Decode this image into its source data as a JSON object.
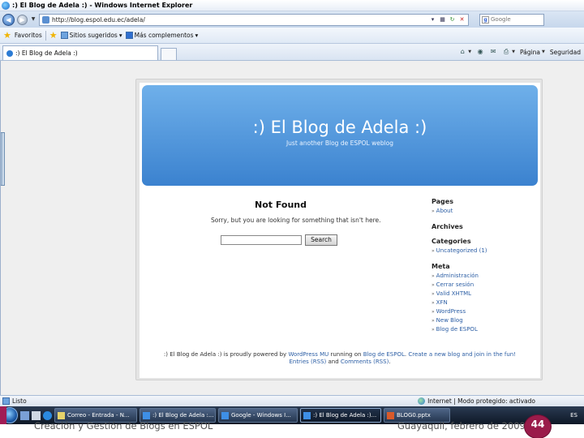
{
  "window": {
    "title": ":) El Blog de Adela :) - Windows Internet Explorer"
  },
  "address": {
    "url": "http://blog.espol.edu.ec/adela/",
    "search_placeholder": "Google"
  },
  "favorites_bar": {
    "favorites_label": "Favoritos",
    "suggested_label": "Sitios sugeridos",
    "addons_label": "Más complementos"
  },
  "tabs": {
    "active_label": ":) El Blog de Adela :)"
  },
  "command_bar": {
    "page_label": "Página",
    "safety_label": "Seguridad"
  },
  "blog": {
    "title": ":) El Blog de Adela :)",
    "description": "Just another Blog de ESPOL weblog",
    "not_found_title": "Not Found",
    "not_found_text": "Sorry, but you are looking for something that isn't here.",
    "search_button": "Search",
    "sidebar": {
      "pages_heading": "Pages",
      "pages": [
        "About"
      ],
      "archives_heading": "Archives",
      "categories_heading": "Categories",
      "categories": [
        "Uncategorized (1)"
      ],
      "meta_heading": "Meta",
      "meta": [
        "Administración",
        "Cerrar sesión",
        "Valid XHTML",
        "XFN",
        "WordPress",
        "New Blog",
        "Blog de ESPOL"
      ]
    },
    "footer": {
      "text_1": ":) El Blog de Adela :) is proudly powered by",
      "link_wordpress": "WordPress MU",
      "text_2": "running on",
      "link_espol": "Blog de ESPOL",
      "text_3": ".",
      "link_create": "Create a new blog and join in the fun!",
      "link_entries": "Entries (RSS)",
      "text_4": "and",
      "link_comments": "Comments (RSS)",
      "text_5": "."
    }
  },
  "status_bar": {
    "status": "Listo",
    "zone": "Internet | Modo protegido: activado"
  },
  "taskbar": {
    "tasks": [
      "Correo - Entrada - N...",
      ":) El Blog de Adela :...",
      "Google - Windows I...",
      ":) El Blog de Adela :)...",
      "BLOG0.pptx"
    ],
    "tray_text": "ES"
  },
  "slide_footer": {
    "left_text": "Creación y Gestión de Blogs en ESPOL",
    "right_text": "Guayaquil, febrero de 2009",
    "page_number": "44"
  },
  "colors": {
    "header_gradient_top": "#6fb0ea",
    "header_gradient_bottom": "#3b82cf",
    "link_blue": "#2d5fa5",
    "badge": "#9a1b4a"
  }
}
